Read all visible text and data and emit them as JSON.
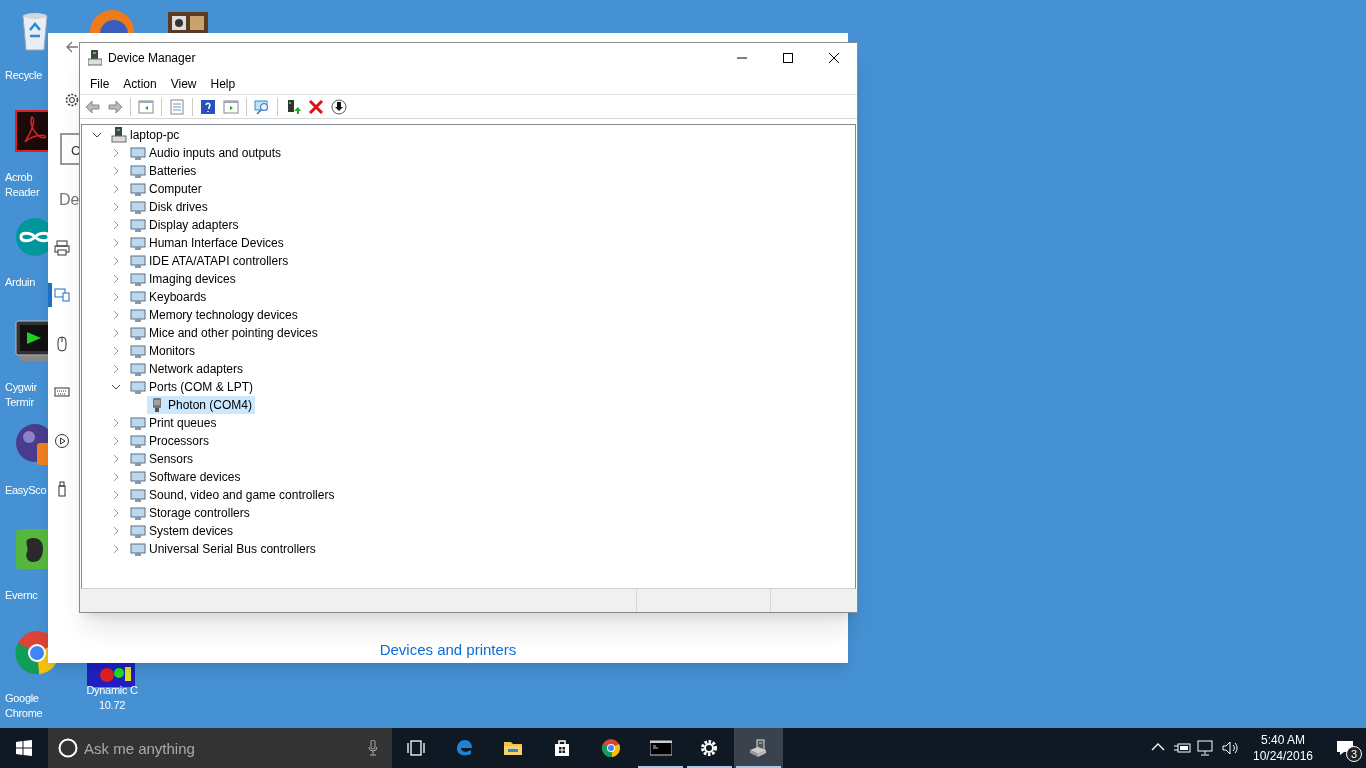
{
  "desktop_icons": [
    {
      "lines": [
        "Recycle"
      ]
    },
    {
      "lines": [
        "Acrob",
        "Reader"
      ]
    },
    {
      "lines": [
        "Arduin"
      ]
    },
    {
      "lines": [
        "Cygwir",
        "Termir"
      ]
    },
    {
      "lines": [
        "EasySco"
      ]
    },
    {
      "lines": [
        "Evernc"
      ]
    },
    {
      "lines": [
        "Google",
        "Chrome"
      ]
    },
    {
      "lines": [
        "Dynamic C",
        "10.72"
      ]
    }
  ],
  "settings_window": {
    "field_text": "C",
    "heading": "De",
    "nav": [
      {
        "selected": false
      },
      {
        "selected": true
      },
      {
        "selected": false
      },
      {
        "selected": false
      },
      {
        "selected": false
      },
      {
        "selected": false
      }
    ],
    "link": "Devices and printers"
  },
  "device_manager": {
    "title": "Device Manager",
    "menu": [
      "File",
      "Action",
      "View",
      "Help"
    ],
    "tree": {
      "label": "laptop-pc",
      "expanded": true,
      "selected": false,
      "children": [
        {
          "label": "Audio inputs and outputs",
          "expanded": false,
          "selected": false
        },
        {
          "label": "Batteries",
          "expanded": false,
          "selected": false
        },
        {
          "label": "Computer",
          "expanded": false,
          "selected": false
        },
        {
          "label": "Disk drives",
          "expanded": false,
          "selected": false
        },
        {
          "label": "Display adapters",
          "expanded": false,
          "selected": false
        },
        {
          "label": "Human Interface Devices",
          "expanded": false,
          "selected": false
        },
        {
          "label": "IDE ATA/ATAPI controllers",
          "expanded": false,
          "selected": false
        },
        {
          "label": "Imaging devices",
          "expanded": false,
          "selected": false
        },
        {
          "label": "Keyboards",
          "expanded": false,
          "selected": false
        },
        {
          "label": "Memory technology devices",
          "expanded": false,
          "selected": false
        },
        {
          "label": "Mice and other pointing devices",
          "expanded": false,
          "selected": false
        },
        {
          "label": "Monitors",
          "expanded": false,
          "selected": false
        },
        {
          "label": "Network adapters",
          "expanded": false,
          "selected": false
        },
        {
          "label": "Ports (COM & LPT)",
          "expanded": true,
          "selected": false,
          "children": [
            {
              "label": "Photon (COM4)",
              "selected": true
            }
          ]
        },
        {
          "label": "Print queues",
          "expanded": false,
          "selected": false
        },
        {
          "label": "Processors",
          "expanded": false,
          "selected": false
        },
        {
          "label": "Sensors",
          "expanded": false,
          "selected": false
        },
        {
          "label": "Software devices",
          "expanded": false,
          "selected": false
        },
        {
          "label": "Sound, video and game controllers",
          "expanded": false,
          "selected": false
        },
        {
          "label": "Storage controllers",
          "expanded": false,
          "selected": false
        },
        {
          "label": "System devices",
          "expanded": false,
          "selected": false
        },
        {
          "label": "Universal Serial Bus controllers",
          "expanded": false,
          "selected": false
        }
      ]
    }
  },
  "taskbar": {
    "search_placeholder": "Ask me anything",
    "apps": [
      {
        "running": false,
        "selected": false
      },
      {
        "running": false,
        "selected": false
      },
      {
        "running": false,
        "selected": false
      },
      {
        "running": false,
        "selected": false
      },
      {
        "running": true,
        "selected": false
      },
      {
        "running": true,
        "selected": false
      },
      {
        "running": true,
        "selected": true
      }
    ],
    "time": "5:40 AM",
    "date": "10/24/2016",
    "notification_count": "3"
  }
}
